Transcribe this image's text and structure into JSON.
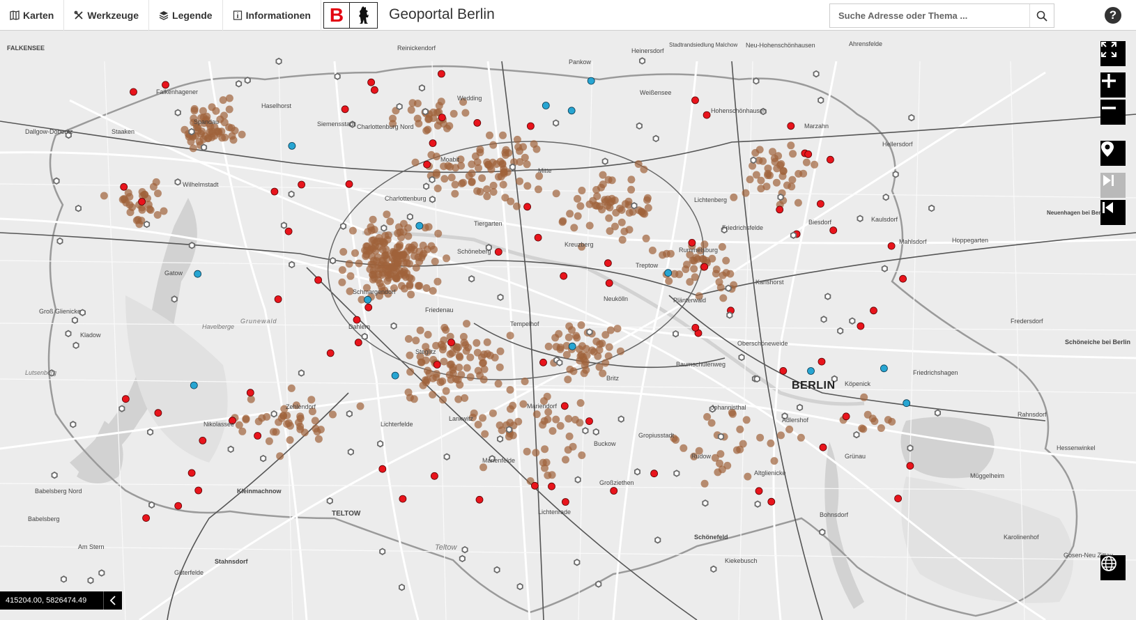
{
  "header": {
    "menu": [
      {
        "label": "Karten",
        "icon": "map-book-icon"
      },
      {
        "label": "Werkzeuge",
        "icon": "tools-icon"
      },
      {
        "label": "Legende",
        "icon": "layers-icon"
      },
      {
        "label": "Informationen",
        "icon": "info-icon"
      }
    ],
    "logo_letter": "B",
    "title": "Geoportal Berlin",
    "search_placeholder": "Suche Adresse oder Thema ...",
    "help_label": "?"
  },
  "controls": [
    "fullscreen-icon",
    "zoom-in-icon",
    "zoom-out-icon",
    "locate-icon",
    "forward-icon",
    "backward-icon",
    "globe-icon"
  ],
  "footer": {
    "coordinates": "415204.00, 5826474.49"
  },
  "map": {
    "colors": {
      "background": "#ececec",
      "roads": "#ffffff",
      "water": "#d2d2d2",
      "rail": "#555555",
      "boundary": "#999999",
      "marker_brown": "#a0623a",
      "marker_red": "#e8141c",
      "marker_blue": "#27a5d2",
      "marker_gray": "#6a6a6a"
    },
    "places": [
      "FALKENSEE",
      "Dallgow-Döberitz",
      "Staaken",
      "Falkenhagener",
      "Spandau",
      "Haselhorst",
      "Siemensstadt",
      "Charlottenburg Nord",
      "Wilhelmstadt",
      "Gatow",
      "Groß Glienicke",
      "Kladow",
      "Havelberge",
      "Grunewald",
      "Lutsenberg",
      "Nikolassee",
      "Zehlendorf",
      "Kleinmachnow",
      "TELTOW",
      "Stahnsdorf",
      "Güterfelde",
      "Babelsberg Nord",
      "Babelsberg",
      "Am Stern",
      "Reinickendorf",
      "Wedding",
      "Pankow",
      "Heinersdorf",
      "Stadtrandsiedlung Malchow",
      "Weißensee",
      "Neu-Hohenschönhausen",
      "Hohenschönhausen",
      "Ahrensfelde",
      "Marzahn",
      "Hellersdorf",
      "Kaulsdorf",
      "Mahlsdorf",
      "Hoppegarten",
      "Neuenhagen bei Berlin",
      "Biesdorf",
      "Lichtenberg",
      "Friedrichsfelde",
      "Rummelsburg",
      "Karlshorst",
      "Moabit",
      "Mitte",
      "Charlottenburg",
      "Tiergarten",
      "Schöneberg",
      "Kreuzberg",
      "Treptow",
      "Plänterwald",
      "Neukölln",
      "Tempelhof",
      "Friedenau",
      "Schmargendorf",
      "Dahlem",
      "Steglitz",
      "Lichterfelde",
      "Lankwitz",
      "Mariendorf",
      "Marienfelde",
      "Lichtenrade",
      "Britz",
      "Buckow",
      "Gropiusstadt",
      "Rudow",
      "Johannisthal",
      "Baumschulenweg",
      "Oberschöneweide",
      "Adlershof",
      "Altglienicke",
      "BERLIN",
      "Köpenick",
      "Friedrichshagen",
      "Grünau",
      "Bohnsdorf",
      "Schönefeld",
      "Kiekebusch",
      "Müggelheim",
      "Rahnsdorf",
      "Schöneiche bei Berlin",
      "Fredersdorf",
      "Karolinenhof",
      "Gosen-Neu Zittau",
      "Hessenwinkel",
      "Teltow",
      "Großziethen"
    ]
  }
}
